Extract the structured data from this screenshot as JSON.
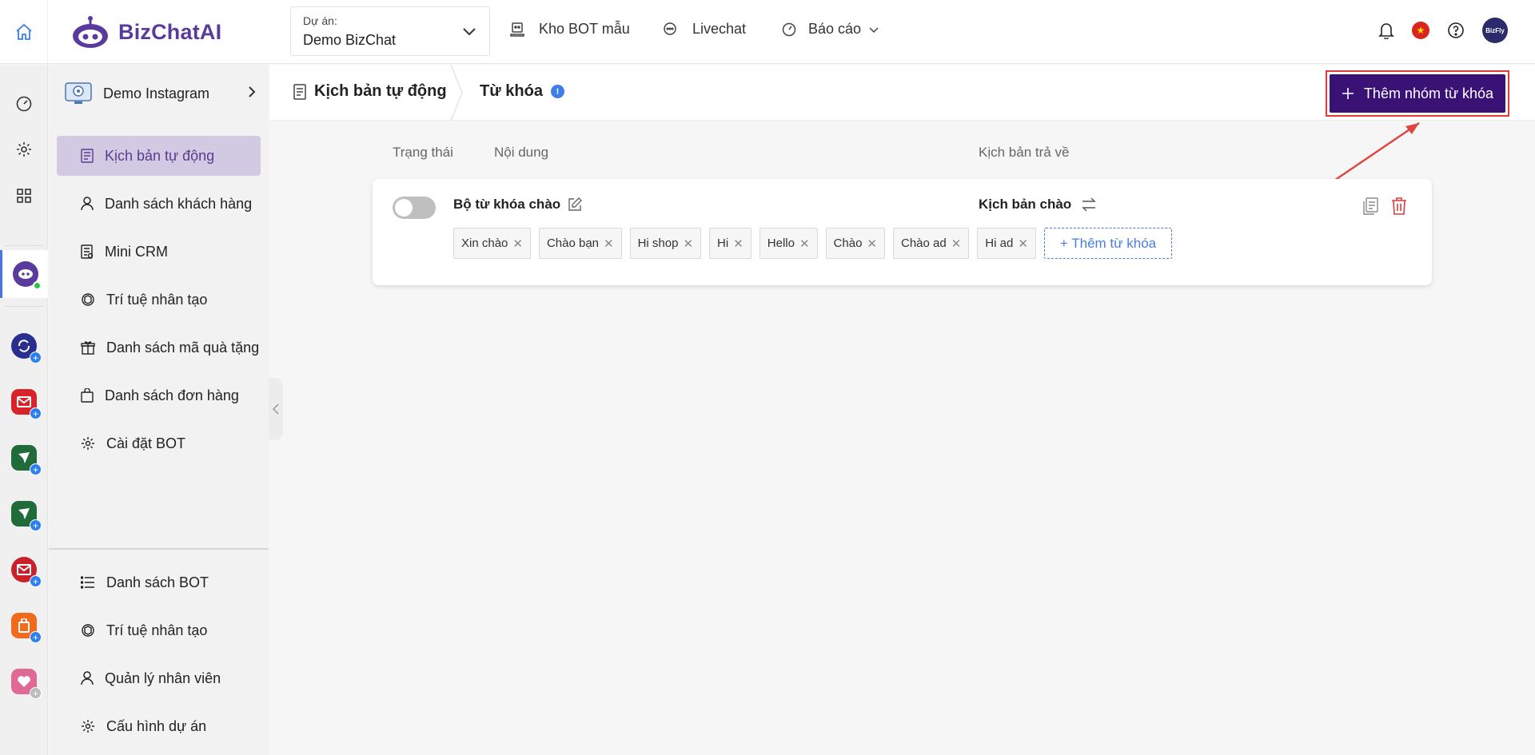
{
  "brand": {
    "name_part1": "BizChat",
    "name_part2": "AI"
  },
  "project": {
    "label": "Dự án:",
    "value": "Demo BizChat"
  },
  "topnav": [
    {
      "label": "Kho BOT mẫu",
      "icon": "robot-icon"
    },
    {
      "label": "Livechat",
      "icon": "chat-icon"
    },
    {
      "label": "Báo cáo",
      "icon": "gauge-icon"
    }
  ],
  "avatar_text": "BizFly",
  "flag_star": "★",
  "sidebar": {
    "bot_name": "Demo Instagram",
    "items": [
      {
        "label": "Kịch bản tự động",
        "icon": "list-doc-icon"
      },
      {
        "label": "Danh sách khách hàng",
        "icon": "user-icon"
      },
      {
        "label": "Mini CRM",
        "icon": "crm-icon"
      },
      {
        "label": "Trí tuệ nhân tạo",
        "icon": "ai-icon"
      },
      {
        "label": "Danh sách mã quà tặng",
        "icon": "gift-icon"
      },
      {
        "label": "Danh sách đơn hàng",
        "icon": "bag-icon"
      },
      {
        "label": "Cài đặt BOT",
        "icon": "gear-icon"
      }
    ],
    "bottom_items": [
      {
        "label": "Danh sách BOT",
        "icon": "list-icon"
      },
      {
        "label": "Trí tuệ nhân tạo",
        "icon": "ai-icon"
      },
      {
        "label": "Quản lý nhân viên",
        "icon": "user-icon"
      },
      {
        "label": "Cấu hình dự án",
        "icon": "gear-icon"
      }
    ]
  },
  "header": {
    "crumb1": "Kịch bản tự động",
    "crumb2": "Từ khóa",
    "info": "!",
    "add_group_button": "Thêm nhóm từ khóa"
  },
  "table": {
    "col_status": "Trạng thái",
    "col_content": "Nội dung",
    "col_script": "Kịch bản trả về",
    "row": {
      "enabled": false,
      "keyword_group": "Bộ từ khóa chào",
      "script": "Kịch bản chào",
      "tags": [
        "Xin chào",
        "Chào bạn",
        "Hi shop",
        "Hi",
        "Hello",
        "Chào",
        "Chào ad",
        "Hi ad"
      ],
      "add_keyword": "+ Thêm từ khóa"
    }
  },
  "colors": {
    "accent": "#3a1276",
    "brand": "#5b3a9e",
    "active_menu": "#d2c9e3",
    "link": "#4a7de2",
    "danger": "#e03a3a"
  }
}
